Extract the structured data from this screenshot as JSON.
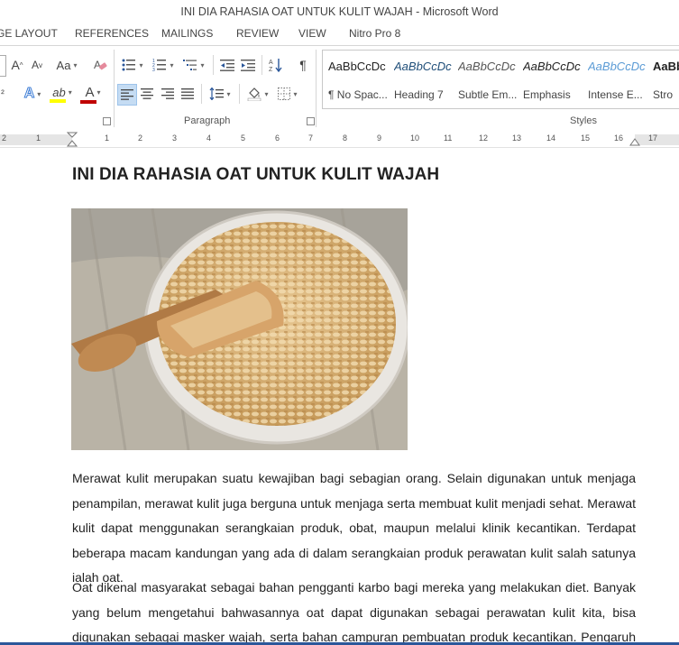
{
  "window": {
    "title": "INI DIA RAHASIA OAT UNTUK KULIT WAJAH - Microsoft Word"
  },
  "tabs": [
    "GE LAYOUT",
    "REFERENCES",
    "MAILINGS",
    "REVIEW",
    "VIEW",
    "Nitro Pro 8"
  ],
  "ribbon": {
    "paragraph_label": "Paragraph",
    "styles_label": "Styles",
    "font_grow": "A",
    "font_shrink": "A",
    "change_case": "Aa",
    "font_color": "A",
    "text_effects": "A",
    "highlight": "ab",
    "pilcrow": "¶",
    "styles": [
      {
        "sample": "AaBbCcDc",
        "name": "¶ No Spac..."
      },
      {
        "sample": "AaBbCcDc",
        "name": "Heading 7"
      },
      {
        "sample": "AaBbCcDc",
        "name": "Subtle Em..."
      },
      {
        "sample": "AaBbCcDc",
        "name": "Emphasis"
      },
      {
        "sample": "AaBbCcDc",
        "name": "Intense E..."
      },
      {
        "sample": "AaBb",
        "name": "Stro"
      }
    ]
  },
  "ruler": {
    "ticks": [
      "2",
      "1",
      "1",
      "2",
      "3",
      "4",
      "5",
      "6",
      "7",
      "8",
      "9",
      "10",
      "11",
      "12",
      "13",
      "14",
      "15",
      "16",
      "17"
    ]
  },
  "document": {
    "heading": "INI DIA RAHASIA OAT UNTUK KULIT WAJAH",
    "paragraph1": "Merawat kulit merupakan suatu kewajiban bagi sebagian orang. Selain digunakan untuk menjaga penampilan, merawat kulit juga berguna untuk menjaga serta membuat kulit menjadi sehat. Merawat kulit dapat menggunakan serangkaian produk, obat, maupun melalui klinik kecantikan. Terdapat beberapa macam kandungan yang ada di dalam serangkaian produk perawatan kulit salah satunya ialah oat.",
    "paragraph2": "Oat dikenal masyarakat sebagai bahan pengganti karbo bagi mereka yang melakukan diet. Banyak yang belum mengetahui bahwasannya oat dapat digunakan sebagai perawatan kulit kita, bisa digunakan sebagai masker wajah, serta bahan campuran pembuatan produk kecantikan. Pengaruh kandungan apa saja yang"
  },
  "colors": {
    "accent": "#2b579a",
    "font_color_bar": "#c00000",
    "highlight_bar": "#ffff00"
  }
}
